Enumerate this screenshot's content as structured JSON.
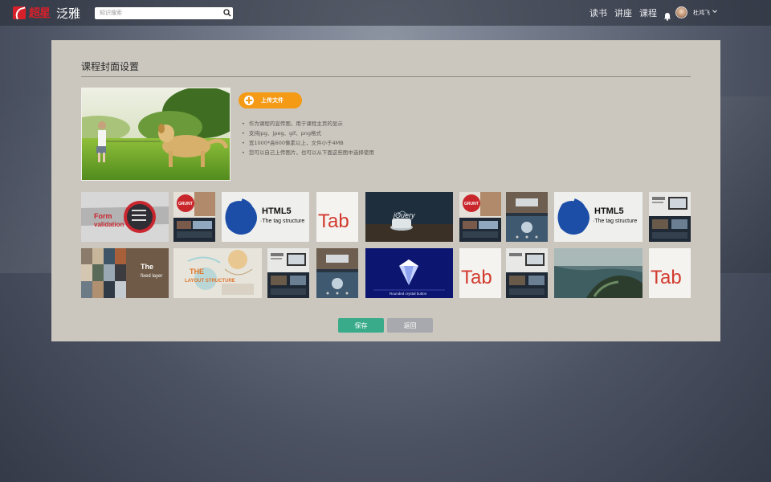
{
  "brand": {
    "logo_mark_icon": "feather-logo-icon",
    "calligraphy": "超星",
    "name": "泛雅"
  },
  "search": {
    "placeholder": "知识搜索",
    "icon": "search-icon"
  },
  "nav": {
    "items": [
      "读书",
      "讲座",
      "课程"
    ],
    "bell_icon": "bell-icon"
  },
  "user": {
    "name": "杜鸿飞",
    "avatar_icon": "avatar",
    "caret_icon": "chevron-down-icon"
  },
  "page": {
    "title": "课程封面设置"
  },
  "upload": {
    "label": "上传文件",
    "icon": "plus-circle-icon",
    "color": "#f59a14"
  },
  "notes": [
    "作为课程的宣传图，用于课程主页的显示",
    "支持jpg、jpeg、gif、png格式",
    "宽1000*高600像素以上，文件小于4MB",
    "您可以自己上传图片，也可以从下面这些图中选择使用"
  ],
  "thumbnails": {
    "row1": [
      {
        "name": "form-validation",
        "texts": [
          "Form",
          "validation"
        ]
      },
      {
        "name": "grunt",
        "texts": [
          "GRUNT"
        ]
      },
      {
        "name": "html5-tag-structure",
        "texts": [
          "HTML5",
          "·The tag structure"
        ]
      },
      {
        "name": "tab",
        "texts": [
          "Tab"
        ]
      },
      {
        "name": "jquery-basic",
        "texts": [
          "jQuery"
        ]
      },
      {
        "name": "grunt-2",
        "texts": [
          "GRUNT"
        ]
      },
      {
        "name": "responsive-phone",
        "texts": []
      },
      {
        "name": "html5-tag-structure-2",
        "texts": [
          "HTML5",
          "·The tag structure"
        ]
      },
      {
        "name": "responsive-screens",
        "texts": []
      }
    ],
    "row2": [
      {
        "name": "fixed-layer",
        "texts": [
          "The",
          "fixed layer"
        ]
      },
      {
        "name": "layout-structure",
        "texts": [
          "THE",
          "LAYOUT STRUCTURE"
        ]
      },
      {
        "name": "responsive-screens-2",
        "texts": []
      },
      {
        "name": "responsive-phone-2",
        "texts": []
      },
      {
        "name": "rounded-crystal-button",
        "texts": [
          "Rounded crystal button"
        ]
      },
      {
        "name": "tab-2",
        "texts": [
          "Tab"
        ]
      },
      {
        "name": "responsive-phone-3",
        "texts": []
      },
      {
        "name": "seaside-cliff",
        "texts": []
      },
      {
        "name": "tab-3",
        "texts": [
          "Tab"
        ]
      }
    ]
  },
  "actions": {
    "save": "保存",
    "back": "返回",
    "save_color": "#3aab8a",
    "back_color": "#a7a9ae"
  }
}
